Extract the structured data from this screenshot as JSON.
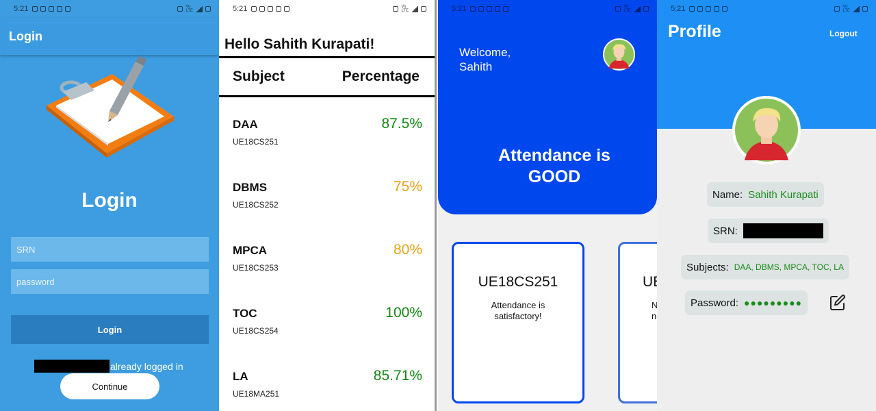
{
  "status_bar": {
    "time": "5:21"
  },
  "login_screen": {
    "appbar_title": "Login",
    "heading": "Login",
    "srn_placeholder": "SRN",
    "password_placeholder": "password",
    "login_button": "Login",
    "already_logged_in": "already logged in",
    "continue_button": "Continue",
    "colors": {
      "background": "#3d9de0",
      "button": "#2a7dbe"
    }
  },
  "subjects_screen": {
    "greeting": "Hello Sahith Kurapati!",
    "col_subject": "Subject",
    "col_percentage": "Percentage",
    "rows": [
      {
        "name": "DAA",
        "code": "UE18CS251",
        "percentage": "87.5%",
        "color": "#118811"
      },
      {
        "name": "DBMS",
        "code": "UE18CS252",
        "percentage": "75%",
        "color": "#e8a317"
      },
      {
        "name": "MPCA",
        "code": "UE18CS253",
        "percentage": "80%",
        "color": "#e8a317"
      },
      {
        "name": "TOC",
        "code": "UE18CS254",
        "percentage": "100%",
        "color": "#118811"
      },
      {
        "name": "LA",
        "code": "UE18MA251",
        "percentage": "85.71%",
        "color": "#118811"
      }
    ]
  },
  "attendance_screen": {
    "welcome_line1": "Welcome,",
    "welcome_line2": "Sahith",
    "status_line1": "Attendance is",
    "status_line2": "GOOD",
    "cards": [
      {
        "code": "UE18CS251",
        "message": "Attendance is satisfactory!"
      },
      {
        "code": "UE",
        "message": "N\nn"
      }
    ],
    "colors": {
      "primary": "#0047ee"
    }
  },
  "profile_screen": {
    "title": "Profile",
    "logout": "Logout",
    "name_label": "Name:",
    "name_value": "Sahith Kurapati",
    "srn_label": "SRN:",
    "subjects_label": "Subjects:",
    "subjects_value": "DAA, DBMS, MPCA, TOC, LA",
    "password_label": "Password:",
    "password_value": "●●●●●●●●●",
    "colors": {
      "header": "#1d8ff5",
      "value": "#1a8c1a"
    }
  }
}
